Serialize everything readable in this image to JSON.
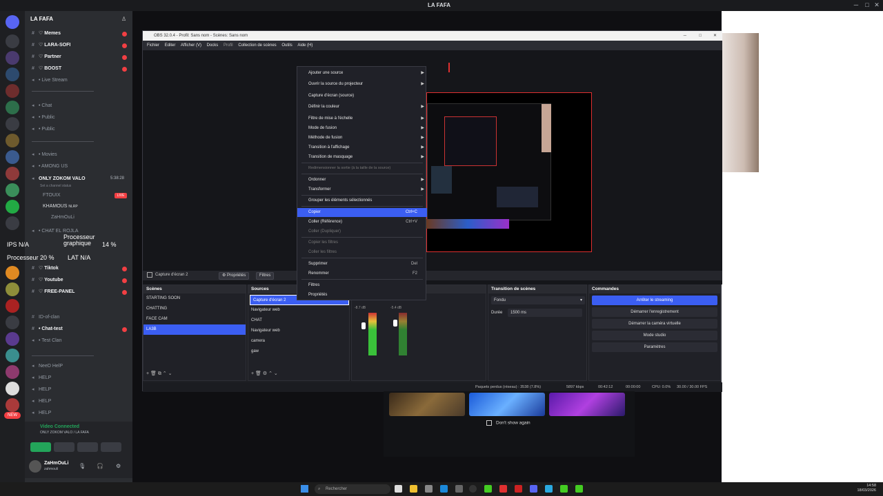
{
  "discord": {
    "window_title": "LA FAFA",
    "server_name": "LA FAFA",
    "channels": [
      {
        "label": "Memes",
        "type": "text",
        "bold": true
      },
      {
        "label": "LARA-SOFI",
        "type": "text",
        "bold": true
      },
      {
        "label": "Partner",
        "type": "text",
        "bold": true
      },
      {
        "label": "BOOST",
        "type": "text",
        "bold": true
      },
      {
        "label": "Live Stream",
        "type": "voice",
        "bold": false
      },
      {
        "label": "Chat",
        "type": "voice",
        "bold": false
      },
      {
        "label": "Public",
        "type": "voice",
        "bold": false
      },
      {
        "label": "Public",
        "type": "voice",
        "bold": false
      },
      {
        "label": "Movies",
        "type": "voice",
        "bold": false
      },
      {
        "label": "AMONG US",
        "type": "voice",
        "bold": false
      },
      {
        "label": "ONLY ZOKOM VALO",
        "type": "voice",
        "bold": true
      },
      {
        "label": "Set a channel status",
        "type": "status",
        "bold": false
      }
    ],
    "voice_members": [
      {
        "name": "FTOUIX",
        "live": "LIVE"
      },
      {
        "name": "KHAMOUS",
        "tag": "NLRP"
      },
      {
        "name": "ZaHmOuLi"
      }
    ],
    "voice_timer": "5:38:28",
    "overlay": {
      "row1_label": "Processeur graphique",
      "row1_value": "14 %",
      "row2_label": "Processeur",
      "row2_value": "20 %",
      "lat": "LAT",
      "lat_value": "N/A",
      "ips": "IPS",
      "ips_value": "N/A"
    },
    "channels2": [
      {
        "label": "CHAT EL ROJLA",
        "type": "voice",
        "bold": false
      },
      {
        "label": "Tiktok",
        "type": "text",
        "bold": true
      },
      {
        "label": "Youtube",
        "type": "text",
        "bold": true
      },
      {
        "label": "FREE-PANEL",
        "type": "text",
        "bold": true
      },
      {
        "label": "ID-of-clan",
        "type": "text",
        "bold": false
      },
      {
        "label": "Chat-test",
        "type": "text",
        "bold": true
      },
      {
        "label": "Test Clan",
        "type": "voice",
        "bold": false
      },
      {
        "label": "NeeD HelP",
        "type": "voice",
        "bold": false
      },
      {
        "label": "HELP",
        "type": "voice",
        "bold": false
      },
      {
        "label": "HELP",
        "type": "voice",
        "bold": false
      },
      {
        "label": "HELP",
        "type": "voice",
        "bold": false
      },
      {
        "label": "HELP",
        "type": "voice",
        "bold": false
      }
    ],
    "voice_connected": "Video Connected",
    "voice_connected_sub": "ONLY ZOKOM VALO / LA FAFA",
    "user": {
      "name": "ZaHmOuLi",
      "status": "zahmouli"
    },
    "new_badge": "NEW"
  },
  "obs": {
    "title": "OBS 32.0.4 - Profil: Sans nom - Scènes: Sans nom",
    "menu": [
      "Fichier",
      "Editer",
      "Afficher (V)",
      "Docks",
      "Profil",
      "Collection de scènes",
      "Outils",
      "Aide (H)"
    ],
    "source_bar": {
      "selected": "Capture d'écran 2",
      "properties": "Propriétés",
      "filters": "Filtres"
    },
    "scenes_title": "Scènes",
    "scenes": [
      "STARTING SOON",
      "CHATTING",
      "FACE CAM",
      "LA3B"
    ],
    "selected_scene": "LA3B",
    "sources_title": "Sources",
    "sources": [
      "Capture d'écran 2",
      "Navigateur web",
      "CHAT",
      "Navigateur web",
      "camera",
      "gaw"
    ],
    "mixer_db": [
      "-8.7 dB",
      "-5.4 dB"
    ],
    "transition_title": "Transition de scènes",
    "transition_type": "Fondu",
    "duration_label": "Durée",
    "duration_value": "1500 ms",
    "commands_title": "Commandes",
    "commands": [
      "Arrêter le streaming",
      "Démarrer l'enregistrement",
      "Démarrer la caméra virtuelle",
      "Mode studio",
      "Paramètres"
    ],
    "status": {
      "dropped": "Paquets perdus (réseau) : 3538 (7.8%)",
      "kbps": "5897 kbps",
      "live_time": "00:42:12",
      "rec_time": "00:00:00",
      "cpu": "CPU: 0.0%",
      "fps": "30.00 / 30.00 FPS"
    }
  },
  "context_menu": [
    {
      "label": "Ajouter une source",
      "arrow": true
    },
    {
      "label": "Ouvrir la source du projecteur",
      "arrow": true
    },
    {
      "label": "Capture d'écran (source)"
    },
    {
      "label": "Définir la couleur",
      "arrow": true
    },
    {
      "label": "Filtre de mise à l'échelle",
      "arrow": true
    },
    {
      "label": "Mode de fusion",
      "arrow": true
    },
    {
      "label": "Méthode de fusion",
      "arrow": true
    },
    {
      "label": "Transition à l'affichage",
      "arrow": true
    },
    {
      "label": "Transition de masquage",
      "arrow": true
    },
    {
      "label": "Redimensionner la sortie (à la taille de la source)",
      "disabled": true
    },
    {
      "label": "Ordonner",
      "arrow": true
    },
    {
      "label": "Transformer",
      "arrow": true
    },
    {
      "label": "Grouper les éléments sélectionnés"
    },
    {
      "label": "Copier",
      "shortcut": "Ctrl+C",
      "highlight": true
    },
    {
      "label": "Coller (Référence)",
      "shortcut": "Ctrl+V"
    },
    {
      "label": "Coller (Dupliquer)",
      "disabled": true
    },
    {
      "label": "Copier les filtres",
      "disabled": true
    },
    {
      "label": "Coller les filtres",
      "disabled": true
    },
    {
      "label": "Supprimer",
      "shortcut": "Del"
    },
    {
      "label": "Renommer",
      "shortcut": "F2"
    },
    {
      "label": "Filtres"
    },
    {
      "label": "Propriétés"
    }
  ],
  "dont_show_again": "Don't show again",
  "taskbar": {
    "search_placeholder": "Rechercher",
    "time": "14:58",
    "date": "18/03/2026"
  },
  "colors": {
    "accent": "#3b5ef2",
    "red": "#e03030",
    "discord_bg": "#2b2d31"
  }
}
